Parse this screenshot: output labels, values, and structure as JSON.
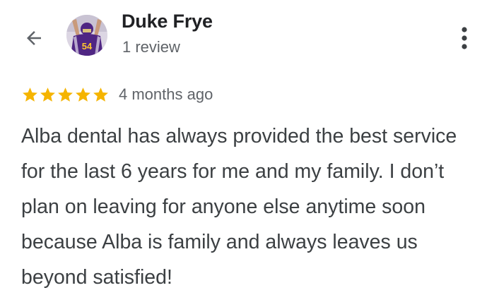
{
  "header": {
    "back_icon": "arrow-left-icon",
    "reviewer_name": "Duke Frye",
    "review_count": "1 review",
    "avatar_jersey_number": "54",
    "more_icon": "more-vert-icon"
  },
  "review": {
    "rating": 5,
    "rating_max": 5,
    "star_color": "#F5B400",
    "date": "4 months ago",
    "text": "Alba dental has always provided the best service for the last 6 years for me and my family. I don’t plan on leaving for anyone else anytime soon because Alba is family and always leaves us beyond satisfied!"
  }
}
